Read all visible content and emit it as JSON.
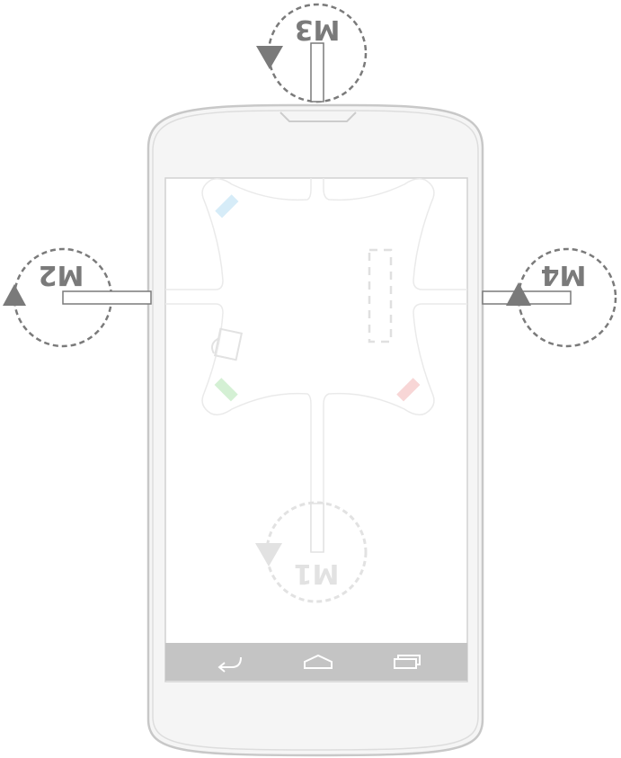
{
  "motors": [
    {
      "id": "m1",
      "label": "M1",
      "faded": true
    },
    {
      "id": "m2",
      "label": "M2",
      "faded": false
    },
    {
      "id": "m3",
      "label": "M3",
      "faded": false
    },
    {
      "id": "m4",
      "label": "M4",
      "faded": false
    }
  ],
  "colors": {
    "marker_blue": "#d6ecf8",
    "marker_green": "#d4f0d4",
    "marker_red": "#f8d6d6",
    "navbar": "#c4c4c4",
    "phone_outline": "#c8c8c8",
    "motor_dark": "#7a7a7a",
    "motor_faded": "#e2e2e2"
  },
  "navbar": {
    "icons": [
      "back-icon",
      "home-icon",
      "recents-icon"
    ]
  }
}
